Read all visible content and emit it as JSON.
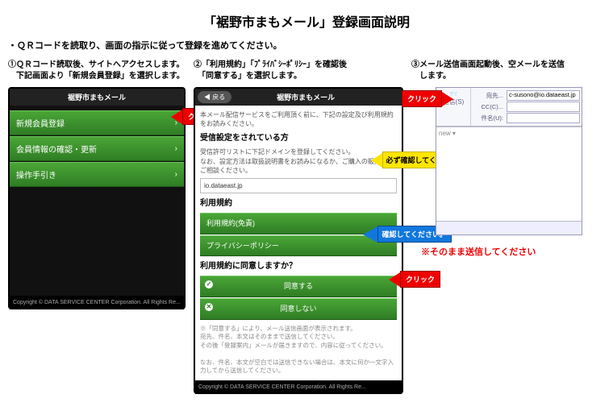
{
  "title": "「裾野市まもメール」登録画面説明",
  "lead": "・ＱＲコードを読取り、画面の指示に従って登録を進めてください。",
  "steps": {
    "s1": "①ＱＲコード読取後、サイトへアクセスします。\n　下記画面より「新規会員登録」を選択します。",
    "s2": "②「利用規約」「ﾌﾟﾗｲﾊﾞｼｰﾎﾟﾘｼｰ」を確認後\n　「同意する」を選択します。",
    "s3": "③メール送信画面起動後、空メールを送信\n　します。"
  },
  "phone_title": "裾野市まもメール",
  "p1": {
    "items": [
      "新規会員登録",
      "会員情報の確認・更新",
      "操作手引き"
    ]
  },
  "p2": {
    "back": "戻る",
    "intro": "本メール配信サービスをご利用頂く前に、下記の設定及び利用規約をお読みください。",
    "recv_h": "受信設定をされている方",
    "recv_t": "受信許可リストに下記ドメインを登録してください。\nなお、設定方法は取扱説明書をお読みになるか、ご購入の販売店にご相談ください。",
    "domain": "io.dataeast.jp",
    "terms_h": "利用規約",
    "btn_terms": "利用規約(免責)",
    "btn_priv": "プライバシーポリシー",
    "agree_q": "利用規約に同意しますか？",
    "btn_agree": "同意する",
    "btn_disagree": "同意しない",
    "note": "※「同意する」により、メール送信画面が表示されます。\n宛先、件名、本文はそのままで送信してください。\nその後「登録案内」メールが届きますので、内容に従ってください。\n\nなお、件名、本文が空白では送信できない場合は、本文に何か一文字入力してから送信してください。"
  },
  "copyright": "Copyright © DATA SERVICE CENTER Corporation. All Rights Re...",
  "callouts": {
    "click": "クリック",
    "must": "必ず確認してください。",
    "confirm": "確認してください。"
  },
  "mail": {
    "send": "送信(S)",
    "to_label": "宛先...",
    "to_value": "c-susono@io.dataeast.jp",
    "cc": "CC(C)...",
    "subj": "件名(U):",
    "body": "new ▾"
  },
  "rednote": "※そのまま送信してください"
}
